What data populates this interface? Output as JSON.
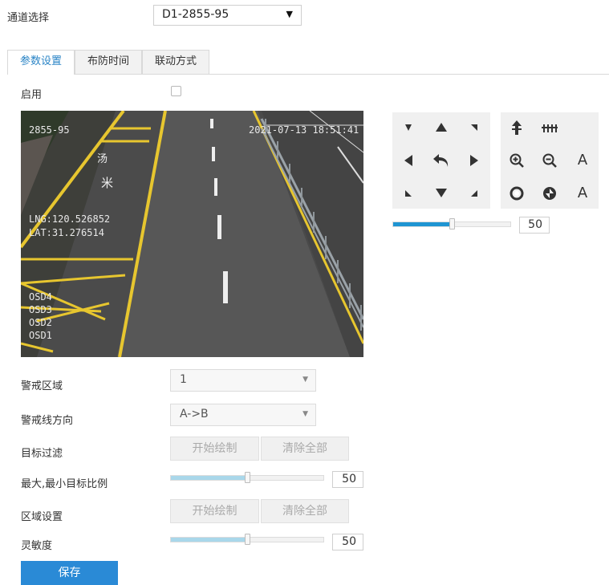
{
  "channel": {
    "label": "通道选择",
    "value": "D1-2855-95"
  },
  "tabs": [
    {
      "label": "参数设置",
      "active": true
    },
    {
      "label": "布防时间",
      "active": false
    },
    {
      "label": "联动方式",
      "active": false
    }
  ],
  "enable": {
    "label": "启用",
    "checked": false
  },
  "video": {
    "osd_camera": "2855-95",
    "osd_datetime": "2021-07-13 18:51:41",
    "osd_lng": "LNG:120.526852",
    "osd_lat": "LAT:31.276514",
    "osd_lines": [
      "OSD4",
      "OSD3",
      "OSD2",
      "OSD1"
    ]
  },
  "ptz": {
    "icons": [
      "up-left-arrow-icon",
      "up-arrow-icon",
      "up-right-arrow-icon",
      "left-arrow-icon",
      "auto-scan-icon",
      "right-arrow-icon",
      "down-left-arrow-icon",
      "down-arrow-icon",
      "down-right-arrow-icon",
      "focus-near-icon",
      "focus-far-icon",
      "zoom-in-icon",
      "zoom-out-icon",
      "iris-open-icon",
      "iris-close-icon"
    ],
    "iris_label_1": "A",
    "iris_label_2": "A",
    "speed": {
      "value": "50",
      "fraction": 0.5
    }
  },
  "alert_zone": {
    "label": "警戒区域",
    "value": "1"
  },
  "line_direction": {
    "label": "警戒线方向",
    "value": "A->B"
  },
  "target_filter": {
    "label": "目标过滤",
    "start_label": "开始绘制",
    "clear_label": "清除全部"
  },
  "target_ratio": {
    "label": "最大,最小目标比例",
    "value": "50",
    "fraction": 0.5
  },
  "region_setting": {
    "label": "区域设置",
    "start_label": "开始绘制",
    "clear_label": "清除全部"
  },
  "sensitivity": {
    "label": "灵敏度",
    "value": "50",
    "fraction": 0.5
  },
  "save_label": "保存",
  "colors": {
    "accent": "#2a8ad6",
    "slider_blue": "#1f95d2",
    "slider_light": "#a9d7ea"
  }
}
